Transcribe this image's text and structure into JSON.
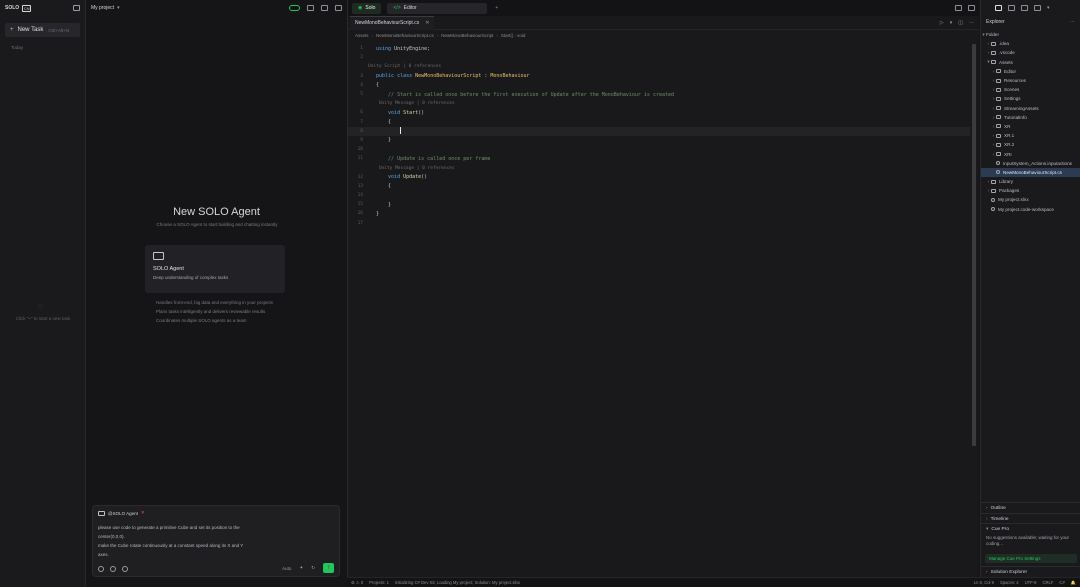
{
  "left_sidebar": {
    "logo_text": "SOLO",
    "logo_badge": "CN",
    "new_task_label": "New Task",
    "new_task_shortcut": "Ctrl+Alt+N",
    "today_label": "Today",
    "empty_text": "Click \"+\" to start a new task"
  },
  "chat": {
    "project_name": "My project",
    "title": "New SOLO Agent",
    "subtitle": "Choose a SOLO Agent to start building and chatting instantly",
    "card_name": "SOLO Agent",
    "card_desc": "Deep understanding of complex tasks",
    "tips": [
      "Handles front-end, big data and everything in your projects",
      "Plans tasks intelligently and delivers reviewable results",
      "Coordinates multiple SOLO agents as a team"
    ],
    "composer_chip": "@SOLO Agent",
    "prompt_lines": [
      "please use code to generate a primitive Cube and set its position to the",
      "center(0,0,0).",
      "make the Cube rotate continuously at a constant speed along its X and Y",
      "axes."
    ],
    "mode_label": "Auto",
    "send_icon": "arrow-up-icon"
  },
  "editor": {
    "tab_solo": "Solo",
    "tab_editor": "Editor",
    "file_tab": "NewMonoBehaviourScript.cs",
    "breadcrumb": [
      "Assets",
      "NewMonoBehaviourScript.cs",
      "NewMonoBehaviourScript",
      "Start() : void"
    ],
    "code_lines": [
      {
        "n": "1",
        "parts": [
          [
            "kw",
            "using "
          ],
          [
            "pl",
            "UnityEngine;"
          ]
        ]
      },
      {
        "n": "2",
        "parts": []
      },
      {
        "lens": "Unity Script | 0 references"
      },
      {
        "n": "3",
        "parts": [
          [
            "kw",
            "public class "
          ],
          [
            "ty",
            "NewMonoBehaviourScript"
          ],
          [
            "pl",
            " : "
          ],
          [
            "ty",
            "MonoBehaviour"
          ]
        ]
      },
      {
        "n": "4",
        "parts": [
          [
            "pl",
            "{"
          ]
        ]
      },
      {
        "n": "5",
        "parts": [
          [
            "cm",
            "    // Start is called once before the first execution of Update after the MonoBehaviour is created"
          ]
        ]
      },
      {
        "lens": "    Unity Message | 0 references"
      },
      {
        "n": "6",
        "parts": [
          [
            "kw",
            "    void "
          ],
          [
            "fn",
            "Start"
          ],
          [
            "pl",
            "()"
          ]
        ]
      },
      {
        "n": "7",
        "parts": [
          [
            "pl",
            "    {"
          ]
        ]
      },
      {
        "n": "8",
        "parts": [
          [
            "pl",
            "        "
          ]
        ],
        "cursor": true
      },
      {
        "n": "9",
        "parts": [
          [
            "pl",
            "    }"
          ]
        ]
      },
      {
        "n": "10",
        "parts": []
      },
      {
        "n": "11",
        "parts": [
          [
            "cm",
            "    // Update is called once per frame"
          ]
        ]
      },
      {
        "lens": "    Unity Message | 0 references"
      },
      {
        "n": "12",
        "parts": [
          [
            "kw",
            "    void "
          ],
          [
            "fn",
            "Update"
          ],
          [
            "pl",
            "()"
          ]
        ]
      },
      {
        "n": "13",
        "parts": [
          [
            "pl",
            "    {"
          ]
        ]
      },
      {
        "n": "14",
        "parts": [
          [
            "pl",
            "        "
          ]
        ]
      },
      {
        "n": "15",
        "parts": [
          [
            "pl",
            "    }"
          ]
        ]
      },
      {
        "n": "16",
        "parts": [
          [
            "pl",
            "}"
          ]
        ]
      },
      {
        "n": "17",
        "parts": []
      }
    ]
  },
  "status_bar": {
    "left": "Projects: 1",
    "mid": "Initializing C# Dev Kit; Loading My project; Solution: My project.slnx",
    "right": [
      "Ln 8, Col 9",
      "Spaces: 4",
      "UTF-8",
      "CRLF",
      "C#"
    ]
  },
  "explorer": {
    "title": "Explorer",
    "root": "Folder",
    "nodes": [
      {
        "label": ".idea",
        "depth": 1,
        "type": "folder"
      },
      {
        "label": ".vscode",
        "depth": 1,
        "type": "folder"
      },
      {
        "label": "Assets",
        "depth": 1,
        "type": "folder",
        "open": true
      },
      {
        "label": "Editor",
        "depth": 2,
        "type": "folder"
      },
      {
        "label": "Resources",
        "depth": 2,
        "type": "folder"
      },
      {
        "label": "Scenes",
        "depth": 2,
        "type": "folder"
      },
      {
        "label": "Settings",
        "depth": 2,
        "type": "folder"
      },
      {
        "label": "StreamingAssets",
        "depth": 2,
        "type": "folder"
      },
      {
        "label": "TutorialInfo",
        "depth": 2,
        "type": "folder"
      },
      {
        "label": "XR",
        "depth": 2,
        "type": "folder"
      },
      {
        "label": "XR.1",
        "depth": 2,
        "type": "folder"
      },
      {
        "label": "XR.2",
        "depth": 2,
        "type": "folder"
      },
      {
        "label": "XRI",
        "depth": 2,
        "type": "folder"
      },
      {
        "label": "InputSystem_Actions.inputactions",
        "depth": 2,
        "type": "file"
      },
      {
        "label": "NewMonoBehaviourScript.cs",
        "depth": 2,
        "type": "file",
        "selected": true
      },
      {
        "label": "Library",
        "depth": 1,
        "type": "folder"
      },
      {
        "label": "Packages",
        "depth": 1,
        "type": "folder"
      },
      {
        "label": "My project.slnx",
        "depth": 1,
        "type": "file"
      },
      {
        "label": "My project.code-workspace",
        "depth": 1,
        "type": "file"
      }
    ],
    "outline": "Outline",
    "timeline": "Timeline",
    "cue_pro": "Cue Pro",
    "cue_pro_text": "No suggestions available; waiting for your coding...",
    "cue_pro_btn": "Manage Cue Pro Settings",
    "solution_explorer": "Solution Explorer"
  }
}
